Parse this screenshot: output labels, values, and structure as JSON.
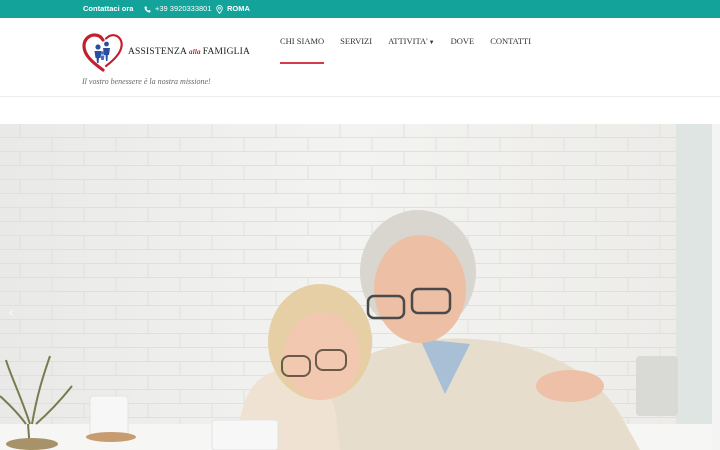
{
  "topbar": {
    "contact_label": "Contattaci ora",
    "phone": "+39 3920333801",
    "city": "ROMA",
    "phone_icon": "phone-icon",
    "location_icon": "map-pin-icon"
  },
  "header": {
    "logo_main_1": "ASSISTENZA",
    "logo_small": "alla",
    "logo_main_2": "FAMIGLIA",
    "tagline": "Il vostro benessere è la nostra missione!"
  },
  "nav": {
    "items": [
      {
        "label": "CHI SIAMO",
        "active": true
      },
      {
        "label": "SERVIZI",
        "active": false
      },
      {
        "label": "ATTIVITA'",
        "active": false,
        "dropdown": true
      },
      {
        "label": "DOVE",
        "active": false
      },
      {
        "label": "CONTATTI",
        "active": false
      }
    ]
  },
  "hero": {
    "prev_icon": "chevron-left-icon",
    "prev_glyph": "‹"
  },
  "colors": {
    "topbar": "#13a39a",
    "accent": "#d63a4a",
    "logo_red": "#b2202e",
    "logo_blue": "#2a4ea0"
  }
}
